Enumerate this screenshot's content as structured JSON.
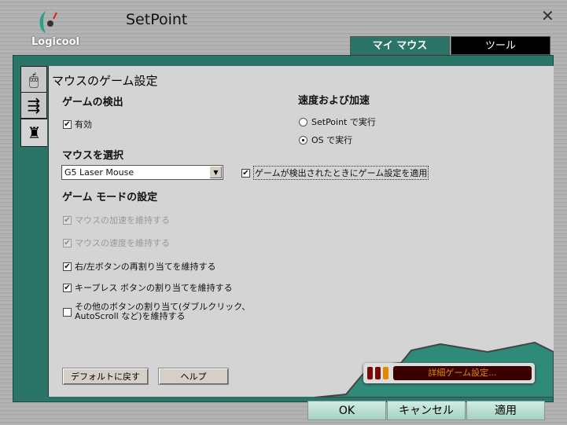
{
  "app": {
    "title": "SetPoint",
    "logo": "Logicool"
  },
  "tabs": [
    {
      "label": "マイ マウス",
      "active": true
    },
    {
      "label": "ツール",
      "active": false
    }
  ],
  "page_title": "マウスのゲーム設定",
  "game_detect": {
    "heading": "ゲームの検出",
    "enabled_label": "有効",
    "enabled": true
  },
  "mouse_select": {
    "heading": "マウスを選択",
    "value": "G5 Laser Mouse"
  },
  "apply_on_detect": {
    "label": "ゲームが検出されたときにゲーム設定を適用",
    "checked": true
  },
  "speed": {
    "heading": "速度および加速",
    "options": [
      {
        "label": "SetPoint で実行",
        "selected": false
      },
      {
        "label": "OS で実行",
        "selected": true
      }
    ]
  },
  "game_mode": {
    "heading": "ゲーム モードの設定",
    "options": [
      {
        "label": "マウスの加速を維持する",
        "checked": true,
        "disabled": true
      },
      {
        "label": "マウスの速度を維持する",
        "checked": true,
        "disabled": true
      },
      {
        "label": "右/左ボタンの再割り当てを維持する",
        "checked": true,
        "disabled": false
      },
      {
        "label": "キープレス ボタンの割り当てを維持する",
        "checked": true,
        "disabled": false
      },
      {
        "label": "その他のボタンの割り当て(ダブルクリック、",
        "label2": "AutoScroll など)を維持する",
        "checked": false,
        "disabled": false
      }
    ]
  },
  "buttons": {
    "default": "デフォルトに戻す",
    "help": "ヘルプ",
    "advanced": "詳細ゲーム設定...",
    "ok": "OK",
    "cancel": "キャンセル",
    "apply": "適用"
  },
  "colors": {
    "teal": "#2a7468",
    "panel": "#d4d4d4",
    "advanced_text": "#e08a00"
  }
}
